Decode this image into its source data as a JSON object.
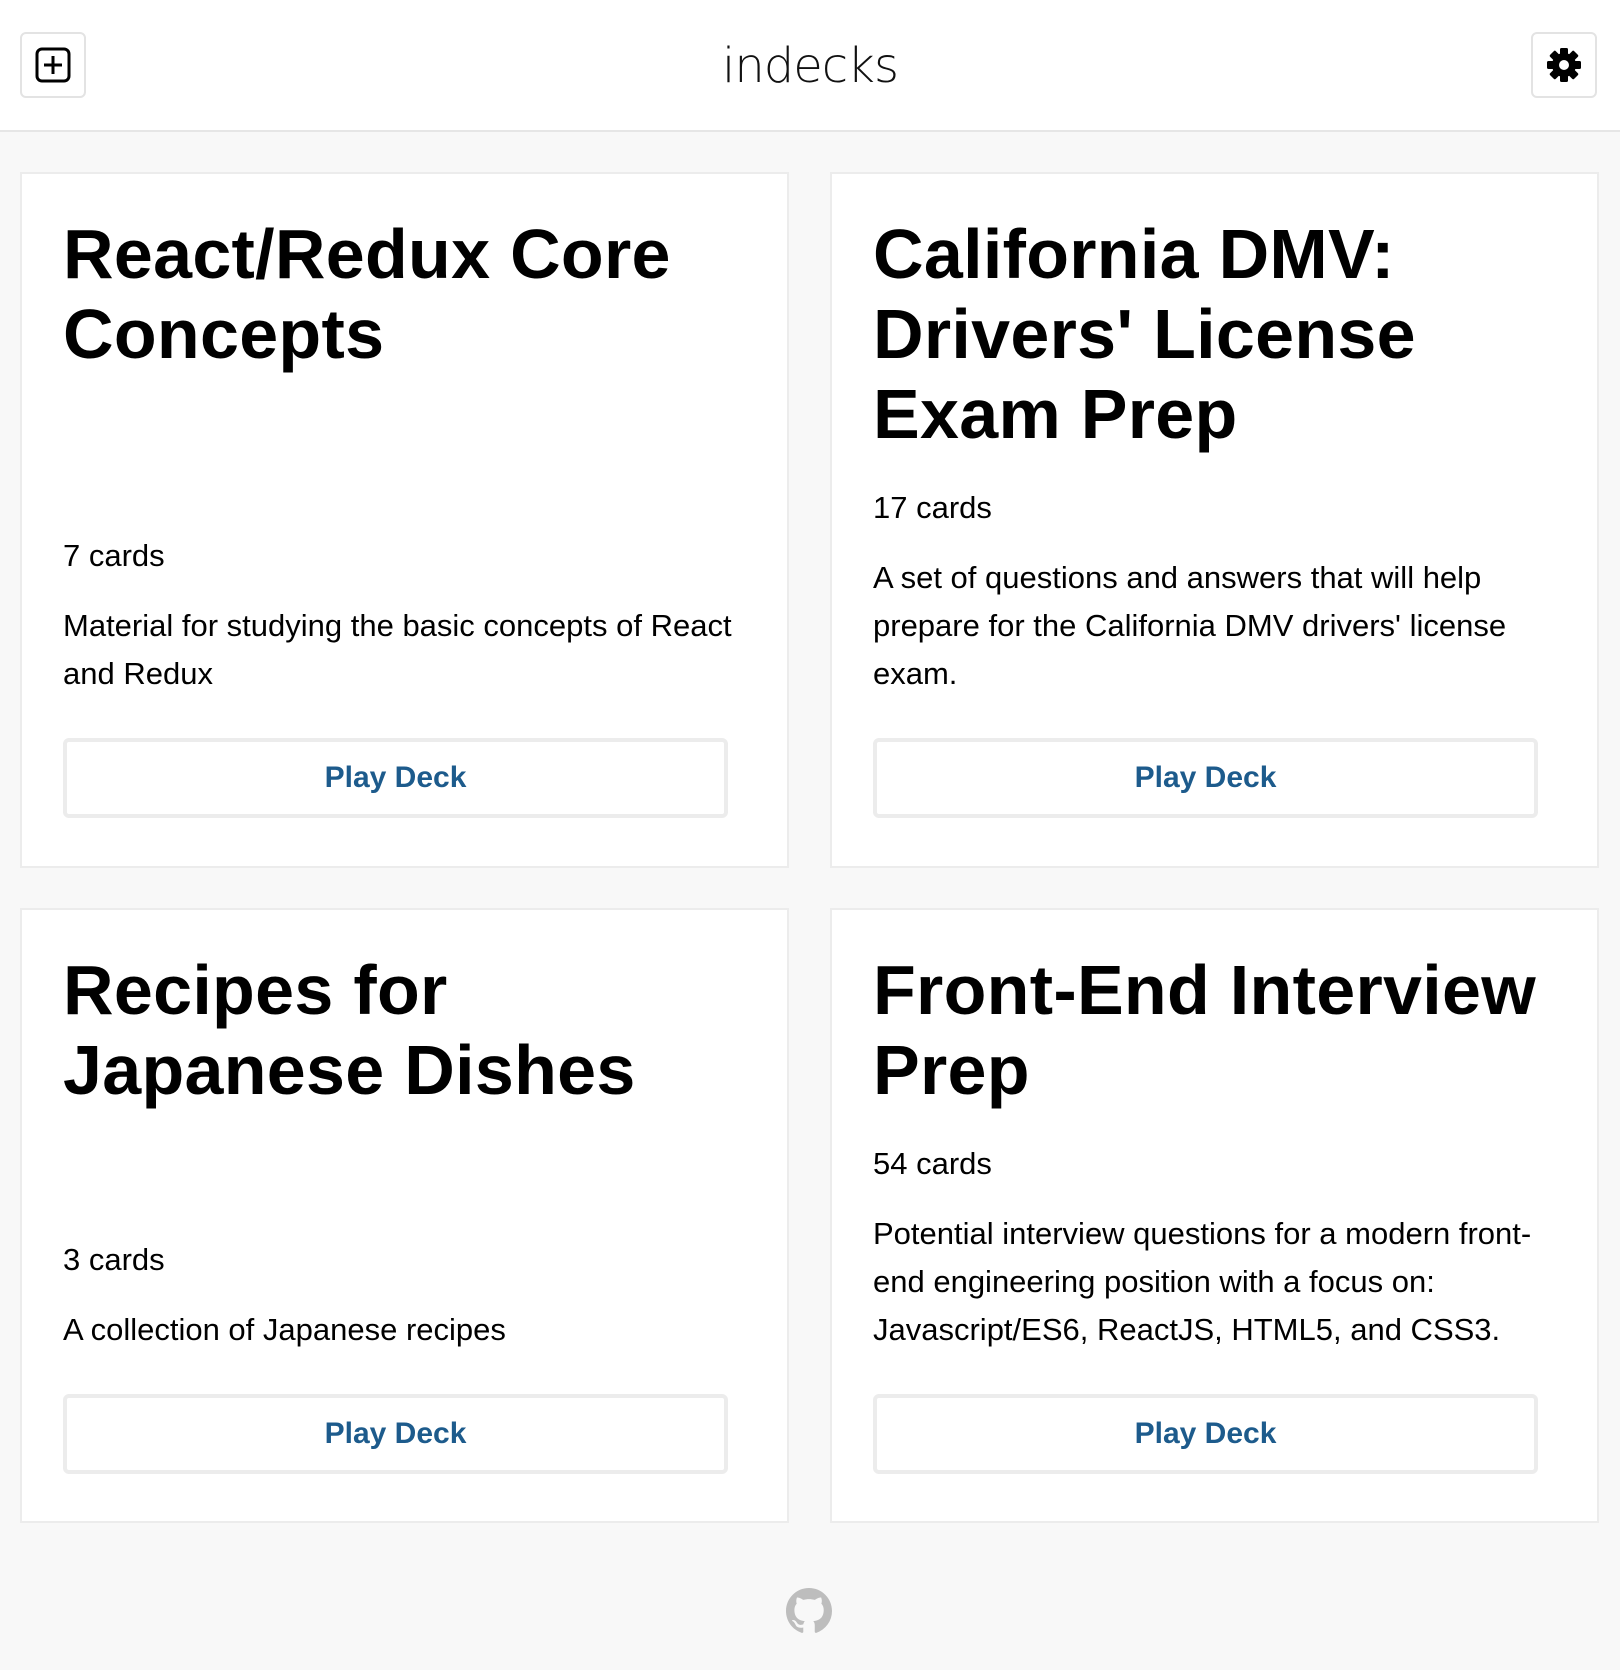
{
  "header": {
    "logo": "indecks",
    "add_icon": "plus-square-icon",
    "settings_icon": "gear-icon"
  },
  "decks": [
    {
      "title": "React/Redux Core Concepts",
      "count": "7 cards",
      "description": "Material for studying the basic concepts of React and Redux",
      "button": "Play Deck"
    },
    {
      "title": "California DMV: Drivers' License Exam Prep",
      "count": "17 cards",
      "description": "A set of questions and answers that will help prepare for the California DMV drivers' license exam.",
      "button": "Play Deck"
    },
    {
      "title": "Recipes for Japanese Dishes",
      "count": "3 cards",
      "description": "A collection of Japanese recipes",
      "button": "Play Deck"
    },
    {
      "title": "Front-End Interview Prep",
      "count": "54 cards",
      "description": "Potential interview questions for a modern front-end engineering position with a focus on: Javascript/ES6, ReactJS, HTML5, and CSS3.",
      "button": "Play Deck"
    }
  ],
  "footer": {
    "icon": "github-icon"
  },
  "colors": {
    "button_text": "#1d5b8c",
    "background": "#f8f8f8"
  }
}
